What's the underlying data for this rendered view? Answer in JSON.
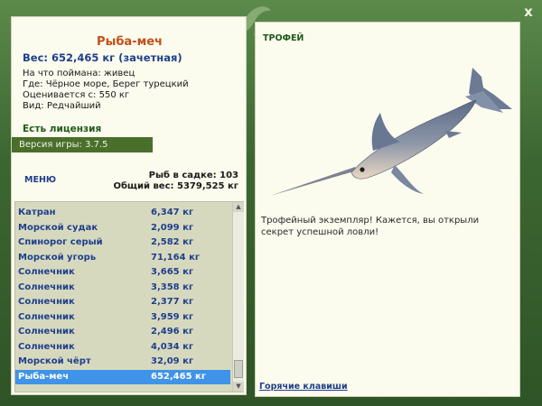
{
  "window": {
    "close_label": "x"
  },
  "fish": {
    "title": "Рыба-меч",
    "weight_line": "Вес: 652,465 кг (зачетная)",
    "info": [
      "На что поймана: живец",
      "Где: Чёрное море, Берег турецкий",
      "Оценивается с: 550 кг",
      "Вид: Редчайший"
    ]
  },
  "license": "Есть лицензия",
  "version": "Версия игры: 3.7.5",
  "menu_label": "МЕНЮ",
  "stats": {
    "cage_count": "Рыб в садке: 103",
    "total_weight": "Общий вес: 5379,525 кг"
  },
  "catch_list": [
    {
      "name": "Катран",
      "weight": "6,347 кг"
    },
    {
      "name": "Морской судак",
      "weight": "2,099 кг"
    },
    {
      "name": "Спинорог серый",
      "weight": "2,582 кг"
    },
    {
      "name": "Морской угорь",
      "weight": "71,164 кг"
    },
    {
      "name": "Солнечник",
      "weight": "3,665 кг"
    },
    {
      "name": "Солнечник",
      "weight": "3,358 кг"
    },
    {
      "name": "Солнечник",
      "weight": "2,377 кг"
    },
    {
      "name": "Солнечник",
      "weight": "3,959 кг"
    },
    {
      "name": "Солнечник",
      "weight": "2,496 кг"
    },
    {
      "name": "Солнечник",
      "weight": "4,034 кг"
    },
    {
      "name": "Морской чёрт",
      "weight": "32,09 кг"
    },
    {
      "name": "Рыба-меч",
      "weight": "652,465 кг",
      "selected": true
    }
  ],
  "trophy": {
    "label": "ТРОФЕЙ",
    "text": "Трофейный экземпляр! Кажется, вы открыли секрет успешной ловли!"
  },
  "hotkeys_link": "Горячие клавиши",
  "colors": {
    "frame": "#3f6b33",
    "panel": "#fbfbee",
    "accent_title": "#c1501a",
    "link_blue": "#1f3f8a",
    "selection": "#3f93e8"
  }
}
